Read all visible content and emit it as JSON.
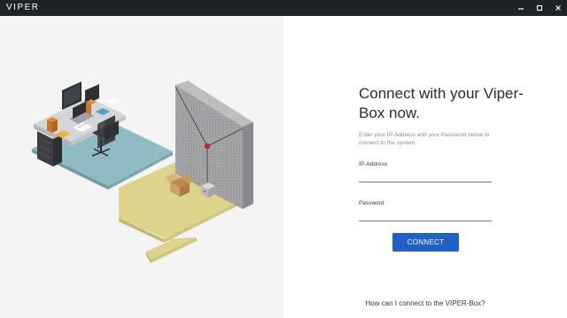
{
  "window": {
    "title": "VIPER",
    "minimize_icon": "minimize-icon",
    "maximize_icon": "maximize-icon",
    "close_icon": "close-icon"
  },
  "illustration": {
    "description_icon": "isometric-office-illustration",
    "colors": {
      "teal_floor": "#8fbcc4",
      "yellow_floor": "#ddd38a",
      "wall_light": "#a9a9ab",
      "wall_dark": "#898a8d",
      "target": "#b5282c"
    }
  },
  "login": {
    "heading": "Connect with your Viper-Box now.",
    "subtext": "Enter your IP-Address and your Password below to connect to the system.",
    "ip_label": "IP-Address",
    "ip_value": "",
    "password_label": "Password",
    "password_value": "",
    "connect_label": "CONNECT",
    "help_link": "How can I connect to the VIPER-Box?"
  },
  "colors": {
    "titlebar": "#1f2226",
    "left_background": "#f4f4f4",
    "button": "#2160c4"
  }
}
